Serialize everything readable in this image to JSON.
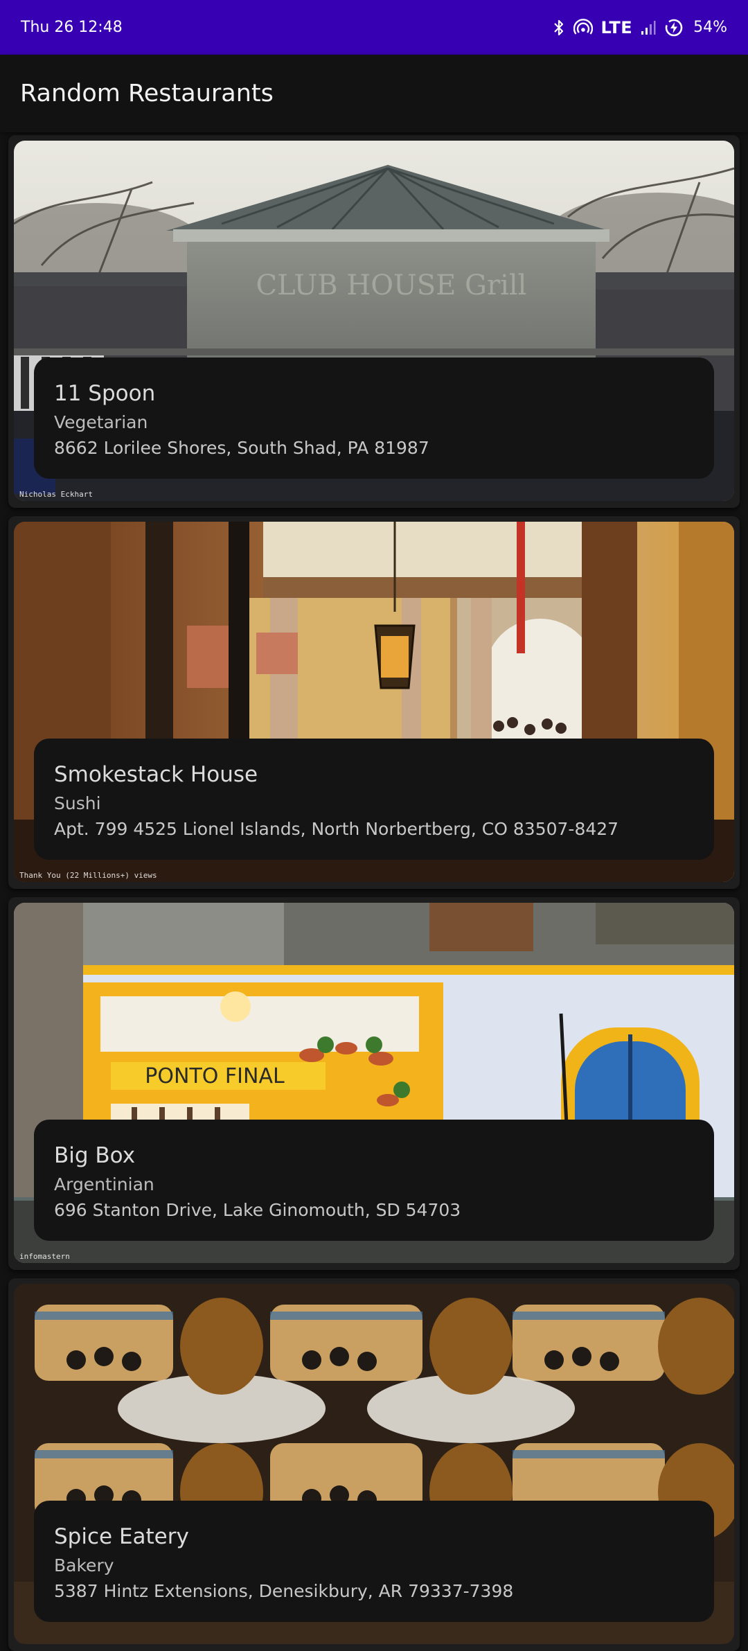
{
  "status_bar": {
    "time": "Thu 26 12:48",
    "network": "LTE",
    "battery": "54%",
    "icons": [
      "bluetooth-icon",
      "hotspot-icon",
      "signal-icon",
      "battery-charging-icon"
    ]
  },
  "app_bar": {
    "title": "Random Restaurants"
  },
  "restaurants": [
    {
      "name": "11 Spoon",
      "cuisine": "Vegetarian",
      "address": "8662 Lorilee Shores, South Shad, PA 81987",
      "photo_credit": "Nicholas Eckhart",
      "photo_sign": "CLUB HOUSE Grill"
    },
    {
      "name": "Smokestack House",
      "cuisine": "Sushi",
      "address": "Apt. 799 4525 Lionel Islands, North Norbertberg, CO 83507-8427",
      "photo_credit": "Thank You (22 Millions+) views"
    },
    {
      "name": "Big Box",
      "cuisine": "Argentinian",
      "address": "696 Stanton Drive, Lake Ginomouth, SD 54703",
      "photo_credit": "infomastern",
      "photo_sign": "PONTO FINAL"
    },
    {
      "name": "Spice Eatery",
      "cuisine": "Bakery",
      "address": "5387 Hintz Extensions, Denesikbury, AR 79337-7398"
    }
  ]
}
